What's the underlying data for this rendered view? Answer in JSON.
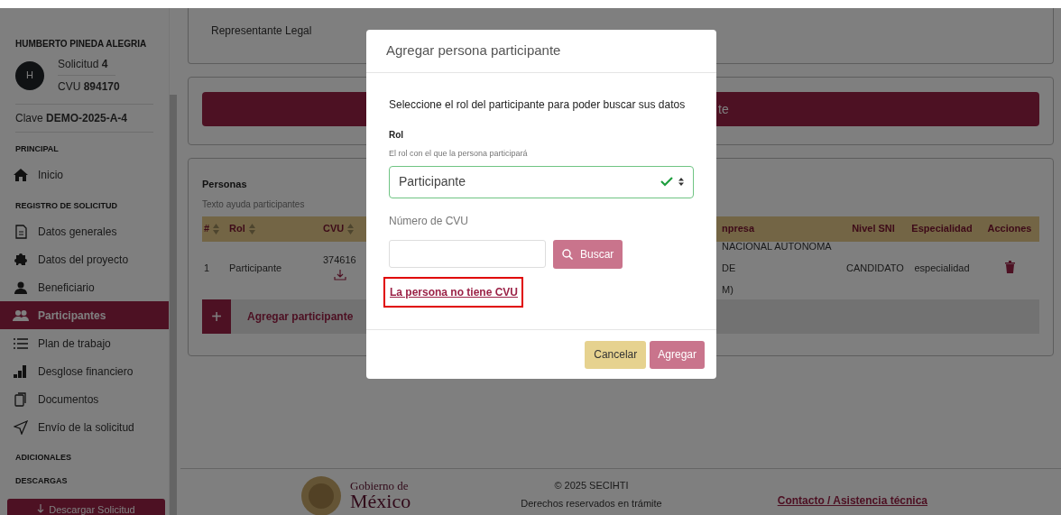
{
  "sidebar": {
    "user_name": "HUMBERTO PINEDA ALEGRIA",
    "avatar_initial": "H",
    "solicitud_label": "Solicitud",
    "solicitud_value": "4",
    "cvu_label": "CVU",
    "cvu_value": "894170",
    "clave_label": "Clave",
    "clave_value": "DEMO-2025-A-4",
    "sections": [
      {
        "title": "PRINCIPAL",
        "items": [
          {
            "label": "Inicio",
            "kind": "home",
            "selected": false
          }
        ]
      },
      {
        "title": "REGISTRO DE SOLICITUD",
        "items": [
          {
            "label": "Datos generales",
            "kind": "doc",
            "selected": false
          },
          {
            "label": "Datos del proyecto",
            "kind": "puzzle",
            "selected": false
          },
          {
            "label": "Beneficiario",
            "kind": "person",
            "selected": false
          },
          {
            "label": "Participantes",
            "kind": "people",
            "selected": true
          },
          {
            "label": "Plan de trabajo",
            "kind": "list",
            "selected": false
          },
          {
            "label": "Desglose financiero",
            "kind": "bars",
            "selected": false
          },
          {
            "label": "Documentos",
            "kind": "docs",
            "selected": false
          },
          {
            "label": "Envío de la solicitud",
            "kind": "send",
            "selected": false
          }
        ]
      },
      {
        "title": "ADICIONALES"
      },
      {
        "title": "DESCARGAS"
      }
    ],
    "download_button": "Descargar Solicitud"
  },
  "main": {
    "representante_label": "Representante Legal",
    "bar_fragment": "te",
    "personas": {
      "title": "Personas",
      "helper": "Texto ayuda participantes",
      "columns": [
        {
          "label": "#",
          "sortable": true
        },
        {
          "label": "Rol",
          "sortable": true
        },
        {
          "label": "CVU",
          "sortable": true
        },
        {
          "label": "npresa",
          "sortable": false
        },
        {
          "label": "Nivel SNI",
          "sortable": false
        },
        {
          "label": "Especialidad",
          "sortable": false
        },
        {
          "label": "Acciones",
          "sortable": false
        }
      ],
      "rows": [
        {
          "cells": [
            "1",
            "Participante",
            "374616",
            "NACIONAL AUTONOMA DE\nM)",
            "CANDIDATO",
            "especialidad"
          ]
        }
      ],
      "add_button": "+",
      "add_label": "Agregar participante"
    }
  },
  "footer": {
    "logo_top": "Gobierno de",
    "logo_bottom": "México",
    "copyright": "© 2025 SECIHTI",
    "rights": "Derechos reservados en trámite",
    "contact_link": "Contacto / Asistencia técnica"
  },
  "modal": {
    "title": "Agregar persona participante",
    "instruction": "Seleccione el rol del participante para poder buscar sus datos",
    "rol_label": "Rol",
    "rol_helper": "El rol con el que la persona participará",
    "rol_value": "Participante",
    "rol_valid": true,
    "cvu_label": "Número de CVU",
    "search_button": "Buscar",
    "no_cvu_link": "La persona no tiene CVU",
    "highlighted": true,
    "cancel_button": "Cancelar",
    "add_button": "Agregar"
  }
}
